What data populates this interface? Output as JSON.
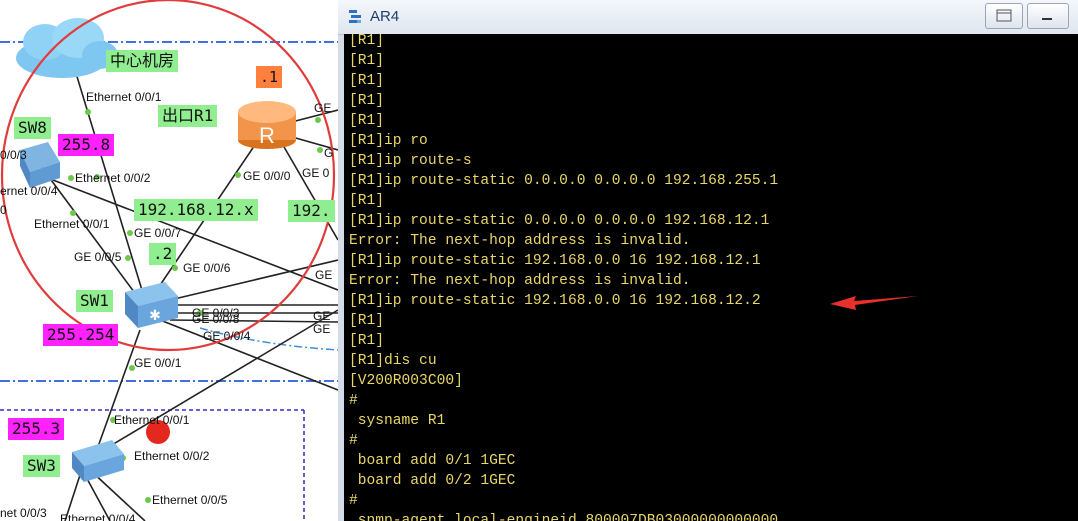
{
  "topology": {
    "labels": {
      "center_room": "中心机房",
      "r1_name": "出口R1",
      "r1_addr": ".1",
      "sw8_name": "SW8",
      "sw8_mask": "255.8",
      "subnet_12": "192.168.12.x",
      "subnet_partial": "192.",
      "sw1_addr": ".2",
      "sw1_name": "SW1",
      "sw1_mask": "255.254",
      "sw3_mask": "255.3",
      "sw3_name": "SW3"
    },
    "ports": {
      "cloud_eth001": "Ethernet 0/0/1",
      "ge_r1_top": "GE",
      "sw8_003": "0/0/3",
      "sw8_eth004": "ernet 0/0/4",
      "sw8_eth002": "Ethernet 0/0/2",
      "sw8_zero": "0",
      "sw8_eth001": "Ethernet 0/0/1",
      "r1_ge000": "GE 0/0/0",
      "r1_ge_right": "GE 0",
      "r1_g_partial": "G",
      "sw1_ge007": "GE 0/0/7",
      "sw1_ge005": "GE 0/0/5",
      "sw1_ge006": "GE 0/0/6",
      "sw1_ge003": "GE 0/0/3",
      "sw1_ge008": "GE 0/0/8",
      "sw1_ge004": "GE 0/0/4",
      "sw1_ge001": "GE 0/0/1",
      "ge_right_1": "GE",
      "ge_right_2": "GE",
      "ge_right_3": "GE",
      "sw3_eth001": "Ethernet 0/0/1",
      "sw3_eth002": "Ethernet 0/0/2",
      "sw3_eth005": "Ethernet 0/0/5",
      "sw3_eth003": "net 0/0/3",
      "sw3_eth004": "Ethernet 0/0/4"
    },
    "colors": {
      "area_label_bg": "#90ee90",
      "mask_label_bg": "#ff22ff",
      "addr_label_bg": "#ff7f3f",
      "highlight_circle": "#e23b3b",
      "zone_border": "#3f6fe0"
    }
  },
  "window": {
    "title": "AR4",
    "icon": "ensp-device-icon",
    "buttons": [
      "restore-button",
      "minimize-button"
    ]
  },
  "console": {
    "text_color": "#e8d668",
    "background": "#000000",
    "lines": [
      "[R1]",
      "[R1]",
      "[R1]",
      "[R1]",
      "[R1]",
      "[R1]ip ro",
      "[R1]ip route-s",
      "[R1]ip route-static 0.0.0.0 0.0.0.0 192.168.255.1",
      "[R1]",
      "[R1]ip route-static 0.0.0.0 0.0.0.0 192.168.12.1",
      "Error: The next-hop address is invalid.",
      "[R1]ip route-static 192.168.0.0 16 192.168.12.1",
      "Error: The next-hop address is invalid.",
      "[R1]ip route-static 192.168.0.0 16 192.168.12.2",
      "[R1]",
      "[R1]",
      "[R1]dis cu",
      "[V200R003C00]",
      "#",
      " sysname R1",
      "#",
      " board add 0/1 1GEC",
      " board add 0/2 1GEC",
      "#",
      " snmp-agent local-engineid 800007DB03000000000000"
    ],
    "annotation": "red-arrow-pointing-left",
    "annotation_color": "#e8312a"
  }
}
